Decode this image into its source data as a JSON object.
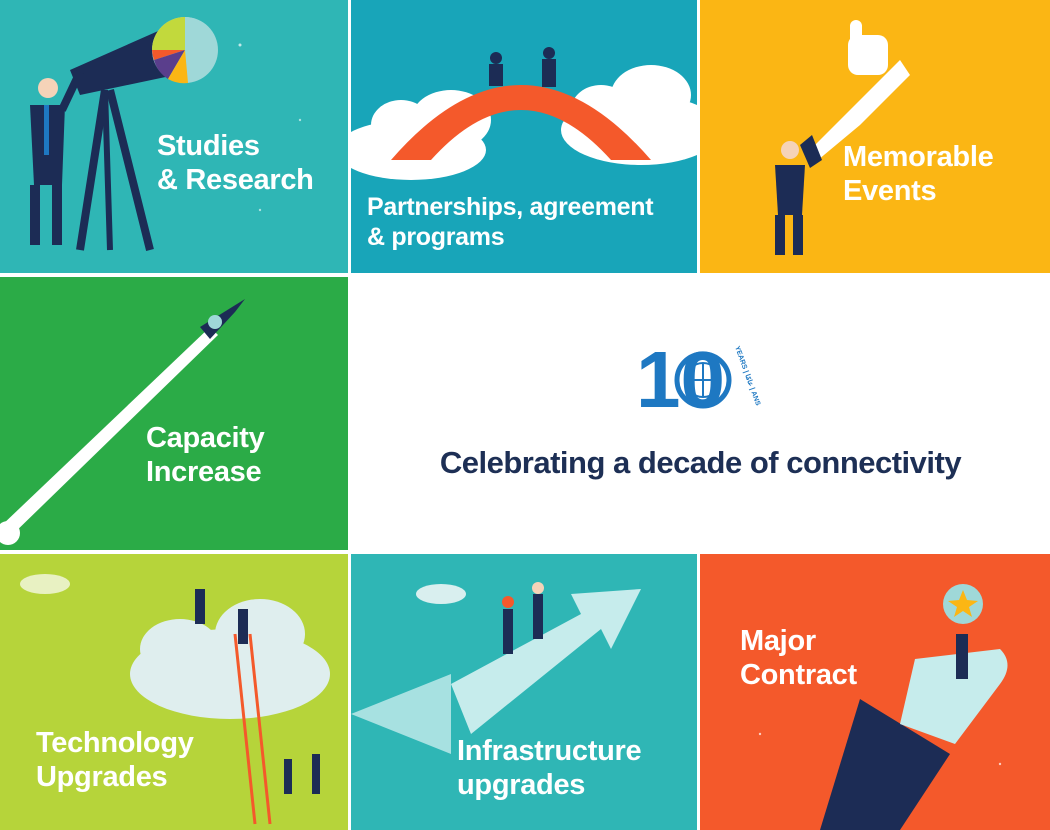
{
  "tiles": {
    "studies": {
      "line1": "Studies",
      "line2": "& Research",
      "color": "#2fb6b5"
    },
    "partnerships": {
      "line1": "Partnerships, agreement",
      "line2": "& programs",
      "color": "#18a5b9"
    },
    "events": {
      "line1": "Memorable",
      "line2": "Events",
      "color": "#fbb614"
    },
    "capacity": {
      "line1": "Capacity",
      "line2": "Increase",
      "color": "#2bab47"
    },
    "technology": {
      "line1": "Technology",
      "line2": "Upgrades",
      "color": "#b6d43a"
    },
    "infrastructure": {
      "line1": "Infrastructure",
      "line2": "upgrades",
      "color": "#2fb6b5"
    },
    "contract": {
      "line1": "Major",
      "line2": "Contract",
      "color": "#f4592b"
    }
  },
  "center": {
    "badge_number": "10",
    "badge_ring_text": "YEARS | عامًا | ANS",
    "tagline": "Celebrating a decade of connectivity",
    "brand_color": "#1e78c2"
  },
  "icons": {
    "studies": "telescope-icon",
    "partnerships": "bridge-puzzle-icon",
    "events": "megaphone-thumbs-up-icon",
    "capacity": "rocket-flight-icon",
    "technology": "cloud-puzzle-icon",
    "infrastructure": "arrow-ride-icon",
    "contract": "hand-star-icon"
  }
}
